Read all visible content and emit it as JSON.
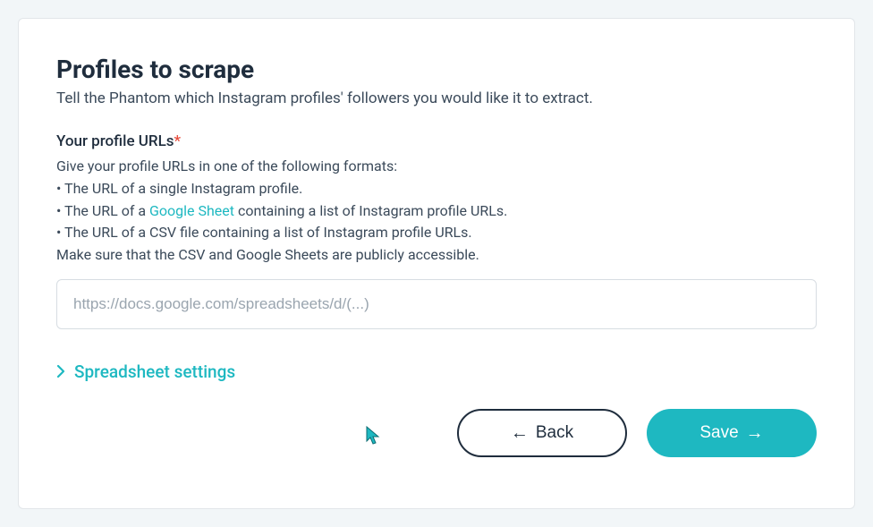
{
  "header": {
    "title": "Profiles to scrape",
    "subtitle": "Tell the Phantom which Instagram profiles' followers you would like it to extract."
  },
  "field": {
    "label": "Your profile URLs",
    "required_mark": "*",
    "desc_intro": "Give your profile URLs in one of the following formats:",
    "bullet1": "• The URL of a single Instagram profile.",
    "bullet2_prefix": "• The URL of a ",
    "bullet2_link": "Google Sheet",
    "bullet2_suffix": " containing a list of Instagram profile URLs.",
    "bullet3": "• The URL of a CSV file containing a list of Instagram profile URLs.",
    "desc_footer": "Make sure that the CSV and Google Sheets are publicly accessible.",
    "placeholder": "https://docs.google.com/spreadsheets/d/(...)"
  },
  "accordion": {
    "label": "Spreadsheet settings"
  },
  "buttons": {
    "back": "Back",
    "save": "Save"
  }
}
